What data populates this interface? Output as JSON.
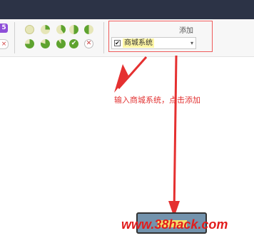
{
  "ribbon": {
    "badge_number": "5",
    "badge_x": "×",
    "progress_icons_row1": [
      "progress-0-icon",
      "progress-25-icon",
      "progress-50-icon",
      "progress-75-icon",
      "progress-90-icon"
    ],
    "progress_icons_row2": [
      "progress-75-icon",
      "progress-90-icon",
      "progress-100-icon",
      "complete-check-icon",
      "cancel-x-icon"
    ],
    "check_glyph": "✔",
    "x_glyph": "✕"
  },
  "tag_panel": {
    "add_label": "添加",
    "tag_checked": true,
    "tag_check_glyph": "✔",
    "tag_name": "商城系统",
    "dropdown_glyph": "▾"
  },
  "annotation": {
    "instruction": "输入商城系统，点击添加",
    "arrow_color": "#e53030"
  },
  "watermark": "www.38hack.com",
  "colors": {
    "topbar": "#2c3346",
    "accent_red": "#ef5b5b",
    "badge_purple": "#8e4fd8",
    "pie_green": "#5ea32f",
    "pie_light": "#e6e6b8"
  }
}
